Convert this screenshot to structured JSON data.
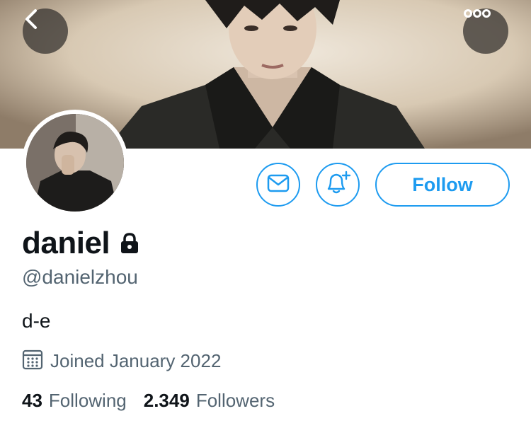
{
  "header": {
    "back_icon": "chevron-left-icon",
    "more_icon": "more-dots-icon"
  },
  "actions": {
    "message_icon": "mail-icon",
    "notify_icon": "bell-plus-icon",
    "follow_label": "Follow",
    "accent_color": "#1d9bf0"
  },
  "profile": {
    "display_name": "daniel",
    "protected_icon": "lock-icon",
    "handle": "@danielzhou",
    "bio": "d-e",
    "joined_icon": "calendar-icon",
    "joined": "Joined January 2022"
  },
  "stats": {
    "following_count": "43",
    "following_label": "Following",
    "followers_count": "2.349",
    "followers_label": "Followers"
  }
}
